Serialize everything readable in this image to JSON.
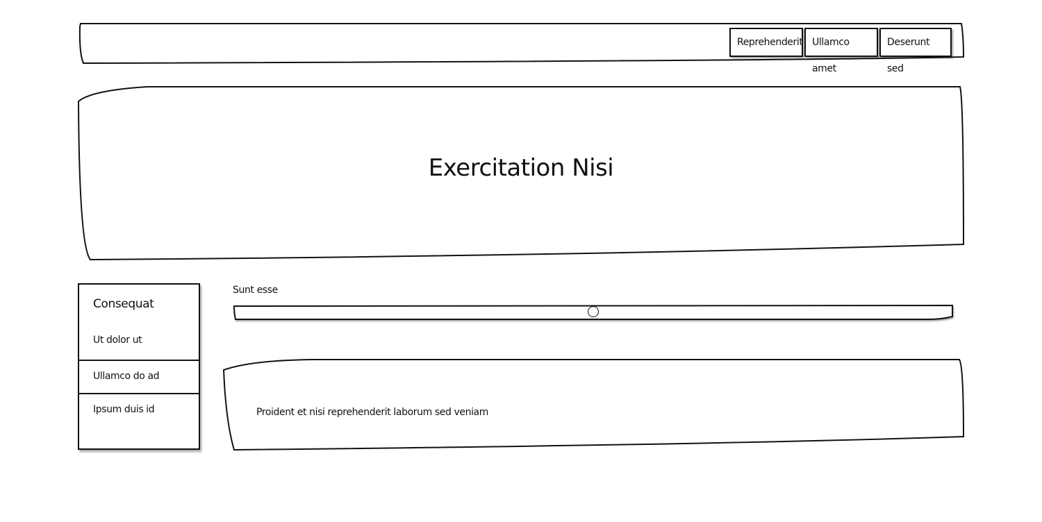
{
  "nav": {
    "items": [
      {
        "label": "Reprehenderit"
      },
      {
        "label": "Ullamco amet"
      },
      {
        "label": "Deserunt sed"
      }
    ]
  },
  "hero": {
    "title": "Exercitation Nisi"
  },
  "sidebar": {
    "heading": "Consequat",
    "items": [
      {
        "label": "Ut dolor ut"
      },
      {
        "label": "Ullamco do ad"
      },
      {
        "label": "Ipsum duis id"
      }
    ]
  },
  "slider": {
    "label": "Sunt esse",
    "value_percent": 50
  },
  "textbox": {
    "text": "Proident et nisi reprehenderit laborum sed veniam"
  }
}
